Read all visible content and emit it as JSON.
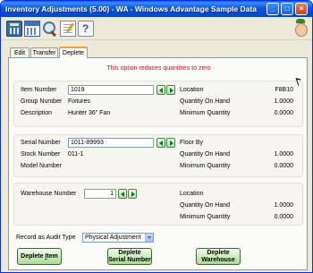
{
  "window": {
    "title": "Inventory Adjustments (5.00) - WA - Windows Advantage Sample Data",
    "minimize": "_",
    "maximize": "□",
    "close": "×"
  },
  "toolbar": {
    "icons": [
      "calculator-icon",
      "calendar-icon",
      "magnifier-icon",
      "notepad-icon",
      "help-icon",
      "mascot-icon"
    ]
  },
  "tabs": [
    {
      "label": "Edit",
      "active": false
    },
    {
      "label": "Transfer",
      "active": false
    },
    {
      "label": "Deplete",
      "active": true
    }
  ],
  "warning": "This option reduces quantities to zero",
  "item": {
    "item_number_label": "Item Number",
    "item_number_value": "1019",
    "group_label": "Group Number",
    "group_value": "Fixtures",
    "description_label": "Description",
    "description_value": "Hunter 36\" Fan",
    "location_label": "Location",
    "location_value": "F8B10",
    "qoh_label": "Quantity On Hand",
    "qoh_value": "1.0000",
    "minq_label": "Minimum Quantity",
    "minq_value": "0.0000"
  },
  "serial": {
    "serial_label": "Serial Number",
    "serial_value": "1011-89993",
    "stock_label": "Stock Number",
    "stock_value": "011-1",
    "model_label": "Model Number",
    "model_value": "",
    "floor_label": "Floor By",
    "floor_value": "",
    "qoh_label": "Quantity On Hand",
    "qoh_value": "1.0000",
    "minq_label": "Minimum Quantity",
    "minq_value": "0.0000"
  },
  "warehouse": {
    "wh_label": "Warehouse Number",
    "wh_value": "1",
    "location_label": "Location",
    "location_value": "",
    "qoh_label": "Quantity On Hand",
    "qoh_value": "1.0000",
    "minq_label": "Minimum Quantity",
    "minq_value": "0.0000"
  },
  "audit": {
    "label": "Record as Audit Type",
    "selected": "Physical Adjustment"
  },
  "buttons": {
    "deplete_item_prefix": "Deplete ",
    "deplete_item_underlined": "I",
    "deplete_item_suffix": "tem",
    "deplete_serial_line1": "Deplete",
    "deplete_serial_line2": "Serial Number",
    "deplete_wh_line1": "Deplete",
    "deplete_wh_line2": "Warehouse"
  }
}
